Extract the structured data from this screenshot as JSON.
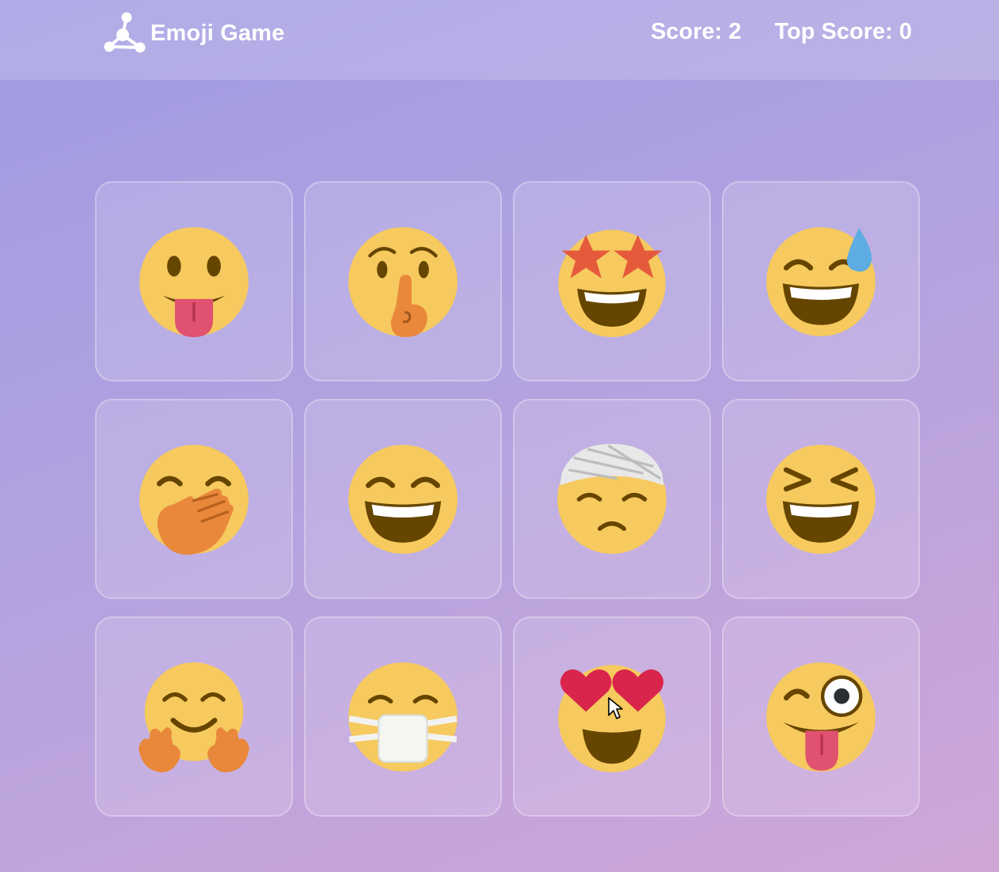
{
  "navbar": {
    "title": "Emoji Game",
    "logo_icon": "molecule-logo-icon",
    "score_label": "Score: 2",
    "top_score_label": "Top Score: 0",
    "score": 2,
    "top_score": 0
  },
  "cards": [
    {
      "emoji": "face-with-tongue"
    },
    {
      "emoji": "shushing-face"
    },
    {
      "emoji": "star-struck"
    },
    {
      "emoji": "grinning-face-with-sweat"
    },
    {
      "emoji": "face-with-hand-over-mouth"
    },
    {
      "emoji": "grinning-face-with-smiling-eyes"
    },
    {
      "emoji": "face-with-head-bandage"
    },
    {
      "emoji": "grinning-squinting-face"
    },
    {
      "emoji": "hugging-face"
    },
    {
      "emoji": "face-with-medical-mask"
    },
    {
      "emoji": "smiling-face-with-heart-eyes"
    },
    {
      "emoji": "winking-face-with-tongue"
    }
  ],
  "colors": {
    "face": "#F6CA5E",
    "feature": "#664500",
    "tongue": "#E0526F",
    "hand": "#E9883B",
    "star": "#E65A3C",
    "heart": "#D9254C",
    "sweat": "#5DADE2"
  }
}
